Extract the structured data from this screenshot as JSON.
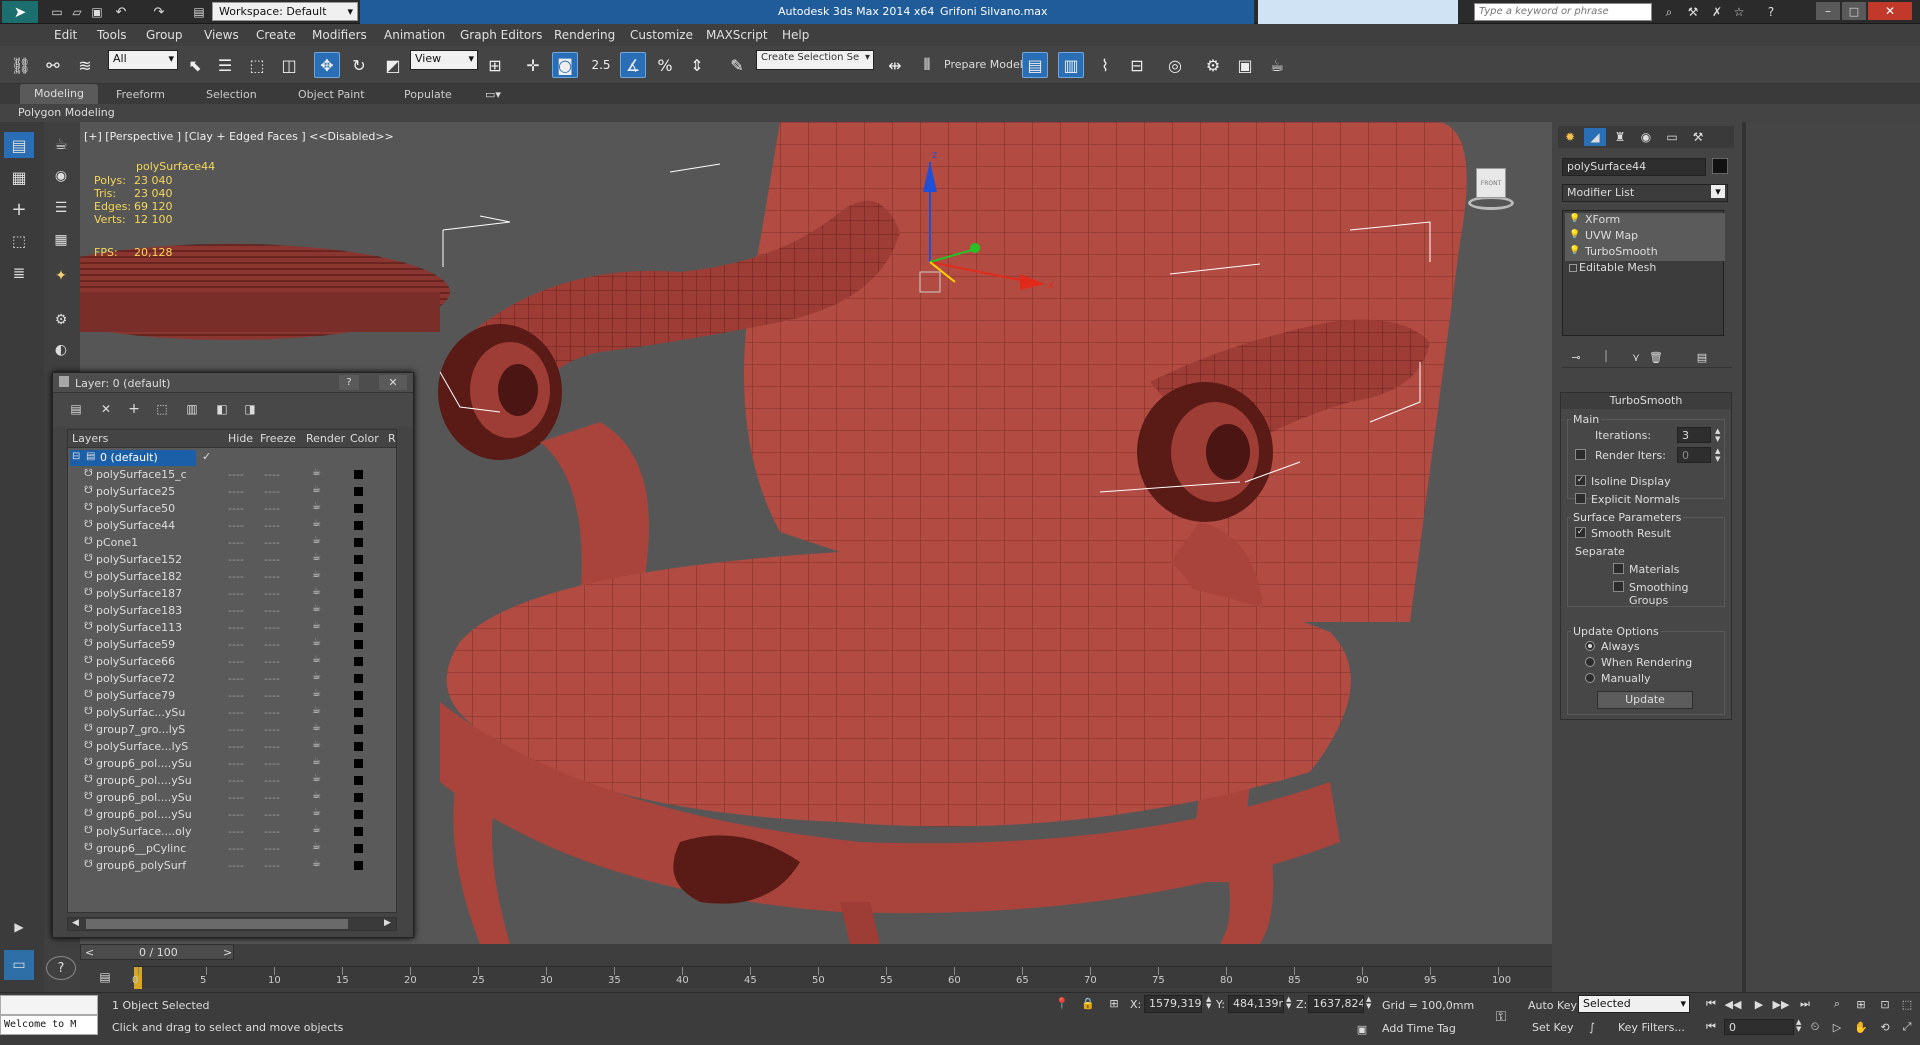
{
  "titlebar": {
    "workspace": "Workspace: Default",
    "app_title": "Autodesk 3ds Max  2014 x64",
    "file_name": "Grifoni Silvano.max",
    "search_placeholder": "Type a keyword or phrase"
  },
  "menu": [
    "Edit",
    "Tools",
    "Group",
    "Views",
    "Create",
    "Modifiers",
    "Animation",
    "Graph Editors",
    "Rendering",
    "Customize",
    "MAXScript",
    "Help"
  ],
  "toolbar": {
    "selection_filter": "All",
    "ref_coord": "View",
    "snap_angle": "2.5",
    "selection_set": "Create Selection Se",
    "prepare_model": "Prepare Model"
  },
  "ribbon": {
    "tabs": [
      "Modeling",
      "Freeform",
      "Selection",
      "Object Paint",
      "Populate"
    ],
    "active_tab": "Modeling",
    "sub_label": "Polygon Modeling"
  },
  "viewport": {
    "label": "[+] [Perspective ] [Clay + Edged Faces ]  <<Disabled>>",
    "stats_object": "polySurface44",
    "stats": [
      {
        "label": "Polys:",
        "value": "23 040"
      },
      {
        "label": "Tris:",
        "value": "23 040"
      },
      {
        "label": "Edges:",
        "value": "69 120"
      },
      {
        "label": "Verts:",
        "value": "12 100"
      }
    ],
    "fps_label": "FPS:",
    "fps_value": "20,128",
    "gizmo_x": "x",
    "gizmo_z": "z",
    "viewcube_label": "FRONT"
  },
  "layer_window": {
    "title": "Layer: 0 (default)",
    "columns": [
      "Layers",
      "Hide",
      "Freeze",
      "Render",
      "Color",
      "R"
    ],
    "default_layer": "0 (default)",
    "items": [
      "polySurface15_c",
      "polySurface25",
      "polySurface50",
      "polySurface44",
      "pCone1",
      "polySurface152",
      "polySurface182",
      "polySurface187",
      "polySurface183",
      "polySurface113",
      "polySurface59",
      "polySurface66",
      "polySurface72",
      "polySurface79",
      "polySurfac...ySu",
      "group7_gro...lyS",
      "polySurface...lyS",
      "group6_pol....ySu",
      "group6_pol....ySu",
      "group6_pol....ySu",
      "group6_pol....ySu",
      "polySurface....oly",
      "group6__pCylinc",
      "group6_polySurf"
    ]
  },
  "command_panel": {
    "object_name": "polySurface44",
    "modifier_list": "Modifier List",
    "stack": [
      "XForm",
      "UVW Map",
      "TurboSmooth",
      "Editable Mesh"
    ],
    "rollout_title": "TurboSmooth",
    "main_label": "Main",
    "iterations_label": "Iterations:",
    "iterations_value": "3",
    "render_iters_label": "Render Iters:",
    "render_iters_value": "0",
    "isoline_label": "Isoline Display",
    "explicit_normals_label": "Explicit Normals",
    "surface_params_label": "Surface Parameters",
    "smooth_result_label": "Smooth Result",
    "separate_label": "Separate",
    "materials_label": "Materials",
    "smoothing_groups_label": "Smoothing Groups",
    "update_options_label": "Update Options",
    "always_label": "Always",
    "when_rendering_label": "When Rendering",
    "manually_label": "Manually",
    "update_button": "Update"
  },
  "timeline": {
    "frame_counter": "0 / 100",
    "prev": "<",
    "next": ">",
    "ticks": [
      "0",
      "5",
      "10",
      "15",
      "20",
      "25",
      "30",
      "35",
      "40",
      "45",
      "50",
      "55",
      "60",
      "65",
      "70",
      "75",
      "80",
      "85",
      "90",
      "95",
      "100"
    ]
  },
  "status": {
    "selected": "1 Object Selected",
    "prompt": "Click and drag to select and move objects",
    "listener": "Welcome to M",
    "x_label": "X:",
    "x_value": "1579,319m",
    "y_label": "Y:",
    "y_value": "484,139mi",
    "z_label": "Z:",
    "z_value": "1637,824m",
    "grid": "Grid = 100,0mm",
    "add_time_tag": "Add Time Tag",
    "auto_key": "Auto Key",
    "set_key": "Set Key",
    "selected_dropdown": "Selected",
    "key_filters": "Key Filters...",
    "frame": "0"
  },
  "colors": {
    "viewport_bg": "#565656",
    "model": "#b24b42",
    "model_dark": "#5a1a16",
    "selection_bracket": "#ffffff",
    "accent_blue": "#1b5fa8"
  }
}
